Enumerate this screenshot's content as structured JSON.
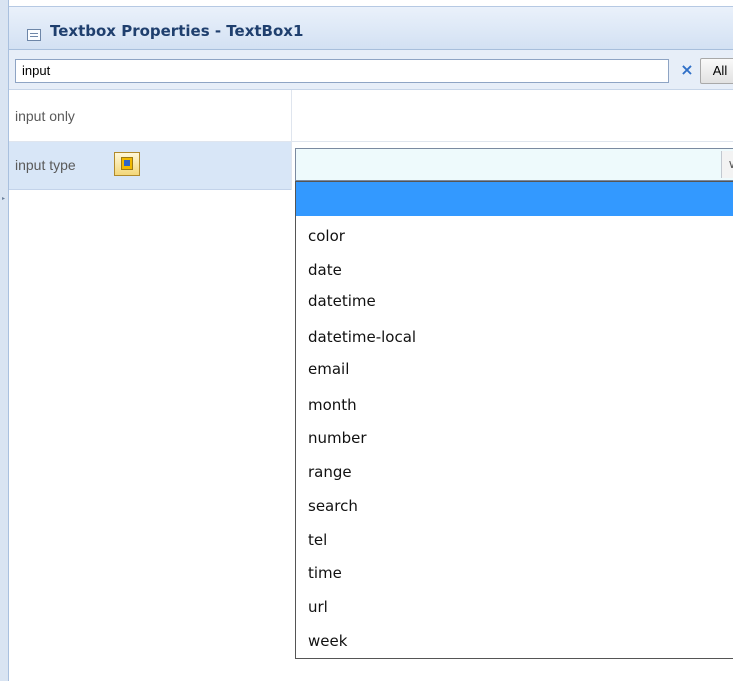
{
  "window": {
    "title": "Textbox Properties - TextBox1"
  },
  "search": {
    "value": "input",
    "clear_symbol": "×",
    "all_label": "All"
  },
  "properties": [
    {
      "label": "input only",
      "value": ""
    },
    {
      "label": "input type",
      "value": ""
    }
  ],
  "dropdown": {
    "selected_index": 0,
    "options": [
      "",
      "color",
      "date",
      "datetime",
      "datetime-local",
      "email",
      "month",
      "number",
      "range",
      "search",
      "tel",
      "time",
      "url",
      "week"
    ]
  },
  "icons": {
    "title": "properties-window-icon",
    "clear": "clear-search-icon",
    "property_editor": "property-editor-icon",
    "dropdown_arrow": "chevron-down-icon"
  },
  "colors": {
    "title_text": "#1f3f6e",
    "highlight": "#3399ff",
    "clear_icon": "#2f6fc7"
  }
}
